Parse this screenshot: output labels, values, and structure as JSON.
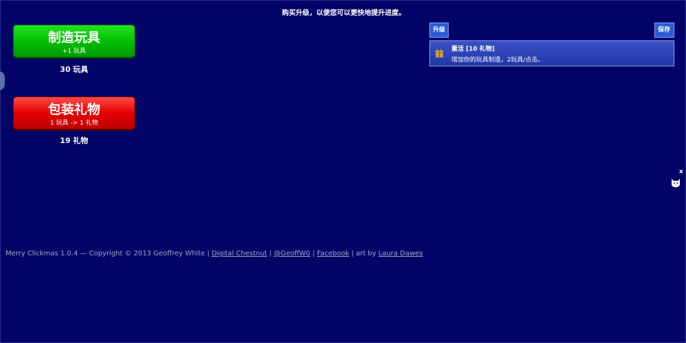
{
  "top_message": "购买升级，以便您可以更快地提升进度。",
  "make_toy": {
    "label": "制造玩具",
    "sub": "+1 玩具",
    "count": "30 玩具",
    "color": "#00c000"
  },
  "wrap_gift": {
    "label": "包装礼物",
    "sub": "1 玩具 -> 1 礼物",
    "count": "19 礼物",
    "color": "#e50000"
  },
  "toolbar": {
    "upgrade_label": "升级",
    "save_label": "保存"
  },
  "upgrades": [
    {
      "icon": "gift-box-icon",
      "title": "重活 [10 礼物]",
      "desc": "增加你的玩具制造，2玩具/点击。"
    }
  ],
  "overlay": {
    "close_label": "x",
    "icon": "cat-icon"
  },
  "footer": {
    "credit": "Merry Clickmas 1.0.4 — Copyright © 2013 Geoffrey White |",
    "link1": "Digital Chestnut",
    "sep1": "|",
    "link2": "@GeoffW0",
    "sep2": "|",
    "link3": "Facebook",
    "art_prefix": "| art by",
    "link4": "Laura Dawes"
  },
  "colors": {
    "background": "#020366",
    "accent": "#2a5bd7"
  }
}
